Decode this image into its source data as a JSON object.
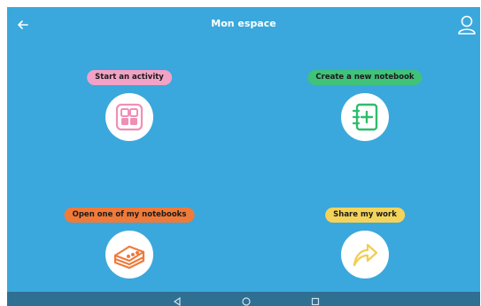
{
  "header": {
    "title": "Mon espace"
  },
  "actions": [
    {
      "id": "start",
      "label": "Start an activity",
      "pill_color": "#f2a2c6",
      "icon": "grid-icon",
      "icon_color": "#f08fb6"
    },
    {
      "id": "create",
      "label": "Create a new notebook",
      "pill_color": "#40c27a",
      "icon": "notebook-plus-icon",
      "icon_color": "#2ebd6d"
    },
    {
      "id": "open",
      "label": "Open one of my notebooks",
      "pill_color": "#f07a3a",
      "icon": "stacked-notebooks-icon",
      "icon_color": "#f07a3a"
    },
    {
      "id": "share",
      "label": "Share my work",
      "pill_color": "#f3d35a",
      "icon": "share-arrow-icon",
      "icon_color": "#f2cc55"
    }
  ],
  "navigation": {
    "buttons": [
      "back-triangle-icon",
      "home-circle-icon",
      "recents-square-icon"
    ]
  }
}
